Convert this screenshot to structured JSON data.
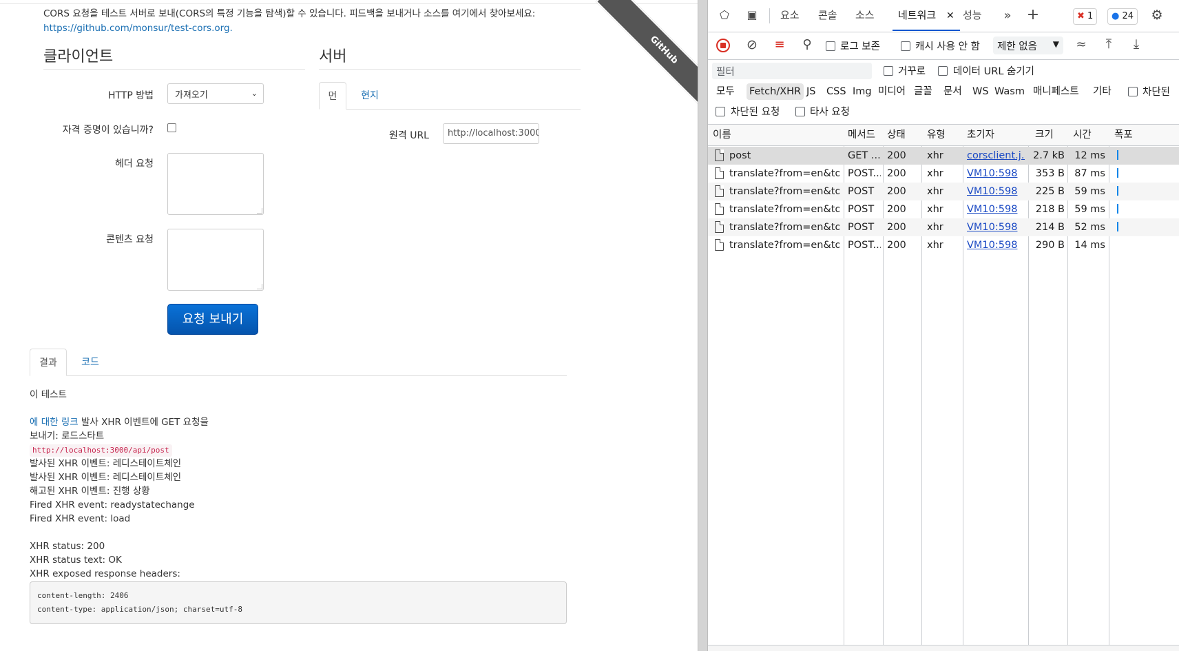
{
  "page": {
    "ribbon_text": "GitHub",
    "intro_text": "CORS 요청을 테스트 서버로 보내(CORS의 특정 기능을 탐색)할 수 있습니다. 피드백을 보내거나 소스를 여기에서 찾아보세요: ",
    "intro_link": "https://github.com/monsur/test-cors.org.",
    "client_title": "클라이언트",
    "server_title": "서버",
    "http_method_label": "HTTP 방법",
    "http_method_value": "가져오기",
    "credentials_label": "자격 증명이 있습니까?",
    "request_headers_label": "헤더 요청",
    "request_content_label": "콘텐츠 요청",
    "send_button": "요청 보내기",
    "server_tabs": [
      "먼",
      "현지"
    ],
    "remote_url_label": "원격 URL",
    "remote_url_value": "http://localhost:3000",
    "result_tabs": [
      "결과",
      "코드"
    ],
    "result": {
      "heading": "이 테스트",
      "link_text": "에 대한 링크",
      "line1_rest": " 발사 XHR 이벤트에 GET 요청을",
      "line2": "보내기: 로드스타트",
      "url_code": "http://localhost:3000/api/post",
      "events": [
        "발사된 XHR 이벤트: 레디스테이트체인",
        "발사된 XHR 이벤트: 레디스테이트체인",
        "해고된 XHR 이벤트: 진행 상황",
        "Fired XHR event: readystatechange",
        "Fired XHR event: load"
      ],
      "status": "XHR status: 200",
      "status_text": "XHR status text: OK",
      "exposed_headers": "XHR exposed response headers:",
      "headers_pre": "content-length: 2406\ncontent-type: application/json; charset=utf-8"
    }
  },
  "devtools": {
    "tabs": [
      "요소",
      "콘솔",
      "소스",
      "네트워크",
      "성능"
    ],
    "active_tab": "네트워크",
    "error_count": "1",
    "message_count": "24",
    "toolbar": {
      "preserve_log": "로그 보존",
      "disable_cache": "캐시 사용 안 함",
      "throttling": "제한 없음"
    },
    "filter": {
      "placeholder": "필터",
      "invert": "거꾸로",
      "hide_data_urls": "데이터 URL 숨기기",
      "types": [
        "모두",
        "Fetch/XHR",
        "JS",
        "CSS",
        "Img",
        "미디어",
        "글꼴",
        "문서",
        "WS",
        "Wasm",
        "매니페스트",
        "기타"
      ],
      "blocked_cookies": "차단된",
      "blocked_requests": "차단된 요청",
      "third_party": "타사 요청"
    },
    "columns": [
      "이름",
      "메서드",
      "상태",
      "유형",
      "초기자",
      "크기",
      "시간",
      "폭포"
    ],
    "requests": [
      {
        "name": "post",
        "method": "GET ...",
        "status": "200",
        "type": "xhr",
        "initiator": "corsclient.j...",
        "size": "2.7 kB",
        "time": "12 ms"
      },
      {
        "name": "translate?from=en&to...",
        "method": "POST...",
        "status": "200",
        "type": "xhr",
        "initiator": "VM10:598",
        "size": "353 B",
        "time": "87 ms"
      },
      {
        "name": "translate?from=en&to...",
        "method": "POST",
        "status": "200",
        "type": "xhr",
        "initiator": "VM10:598",
        "size": "225 B",
        "time": "59 ms"
      },
      {
        "name": "translate?from=en&to...",
        "method": "POST",
        "status": "200",
        "type": "xhr",
        "initiator": "VM10:598",
        "size": "218 B",
        "time": "59 ms"
      },
      {
        "name": "translate?from=en&to...",
        "method": "POST",
        "status": "200",
        "type": "xhr",
        "initiator": "VM10:598",
        "size": "214 B",
        "time": "52 ms"
      },
      {
        "name": "translate?from=en&to...",
        "method": "POST...",
        "status": "200",
        "type": "xhr",
        "initiator": "VM10:598",
        "size": "290 B",
        "time": "14 ms"
      }
    ]
  }
}
